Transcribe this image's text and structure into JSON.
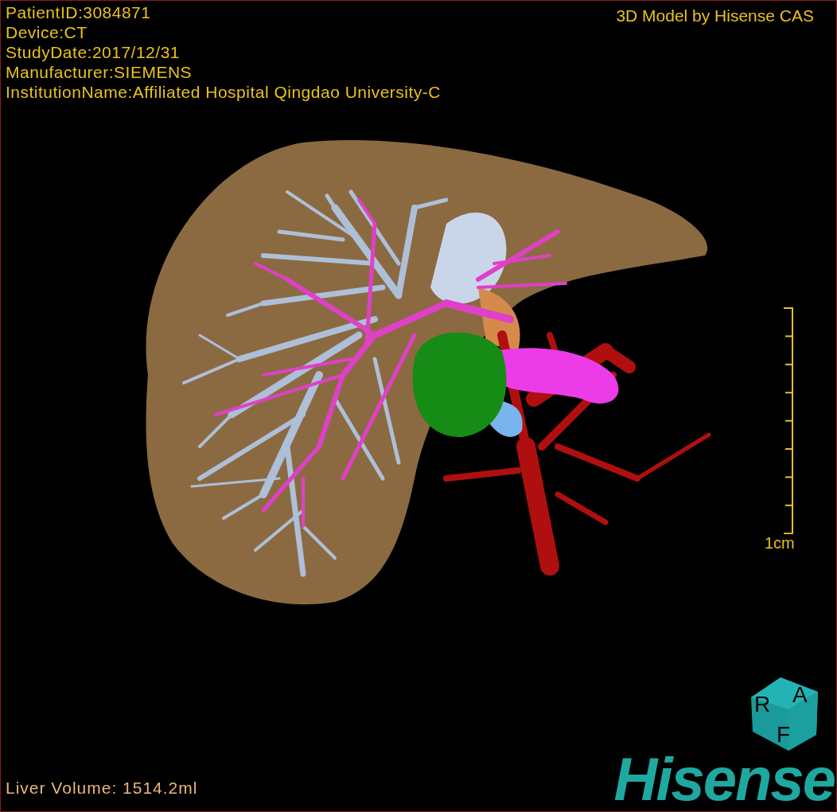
{
  "header": {
    "info": [
      "PatientID:3084871",
      "Device:CT",
      "StudyDate:2017/12/31",
      "Manufacturer:SIEMENS",
      "InstitutionName:Affiliated Hospital Qingdao University-C"
    ],
    "title": "3D Model by Hisense CAS"
  },
  "scale": {
    "label": "1cm"
  },
  "orientation_cube": {
    "faces": [
      "R",
      "A",
      "F"
    ]
  },
  "footer": {
    "measurement": "Liver Volume: 1514.2ml",
    "logo": "Hisense"
  }
}
